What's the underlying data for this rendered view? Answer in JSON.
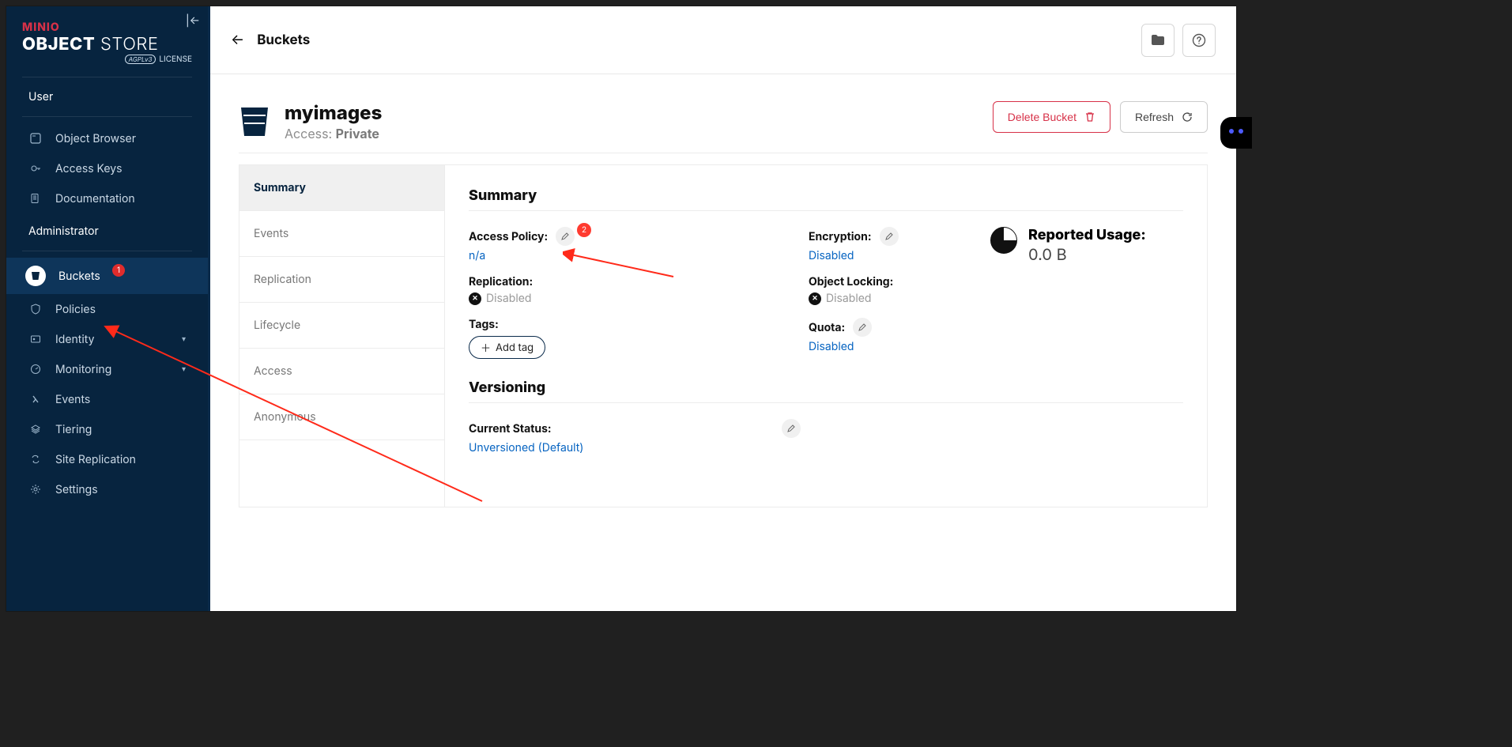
{
  "brand": {
    "minio": "MINIO",
    "object": "OBJECT",
    "store": "STORE",
    "license": "LICENSE",
    "agpl": "AGPLv3"
  },
  "sidebar": {
    "user_section": "User",
    "admin_section": "Administrator",
    "user_items": [
      {
        "label": "Object Browser"
      },
      {
        "label": "Access Keys"
      },
      {
        "label": "Documentation"
      }
    ],
    "admin_items": [
      {
        "label": "Buckets",
        "badge": "1"
      },
      {
        "label": "Policies"
      },
      {
        "label": "Identity",
        "expandable": true
      },
      {
        "label": "Monitoring",
        "expandable": true
      },
      {
        "label": "Events"
      },
      {
        "label": "Tiering"
      },
      {
        "label": "Site Replication"
      },
      {
        "label": "Settings"
      }
    ]
  },
  "header": {
    "title": "Buckets"
  },
  "bucket": {
    "name": "myimages",
    "access_label": "Access:",
    "access_value": "Private",
    "delete": "Delete Bucket",
    "refresh": "Refresh"
  },
  "tabs": [
    "Summary",
    "Events",
    "Replication",
    "Lifecycle",
    "Access",
    "Anonymous"
  ],
  "summary": {
    "heading": "Summary",
    "access_policy": {
      "label": "Access Policy:",
      "value": "n/a"
    },
    "encryption": {
      "label": "Encryption:",
      "value": "Disabled"
    },
    "replication": {
      "label": "Replication:",
      "value": "Disabled"
    },
    "object_locking": {
      "label": "Object Locking:",
      "value": "Disabled"
    },
    "tags": {
      "label": "Tags:",
      "add": "Add tag"
    },
    "quota": {
      "label": "Quota:",
      "value": "Disabled"
    },
    "usage": {
      "label": "Reported Usage:",
      "value": "0.0 B"
    },
    "versioning": {
      "heading": "Versioning",
      "status_label": "Current Status:",
      "status_value": "Unversioned (Default)"
    }
  },
  "annotations": {
    "badge2": "2"
  }
}
